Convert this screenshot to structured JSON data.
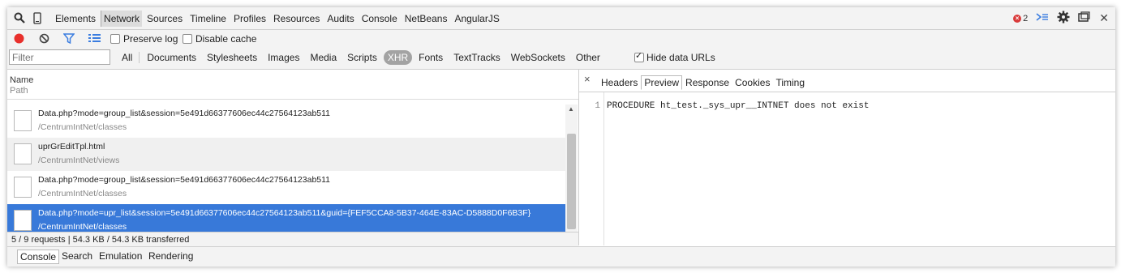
{
  "main_tabs": [
    "Elements",
    "Network",
    "Sources",
    "Timeline",
    "Profiles",
    "Resources",
    "Audits",
    "Console",
    "NetBeans",
    "AngularJS"
  ],
  "active_main_tab": "Network",
  "error_count": "2",
  "toolbar": {
    "preserve_log": "Preserve log",
    "disable_cache": "Disable cache"
  },
  "filter": {
    "placeholder": "Filter",
    "types": [
      "All",
      "Documents",
      "Stylesheets",
      "Images",
      "Media",
      "Scripts",
      "XHR",
      "Fonts",
      "TextTracks",
      "WebSockets",
      "Other"
    ],
    "active_type": "XHR",
    "hide_data_urls": "Hide data URLs"
  },
  "columns": {
    "name": "Name",
    "path": "Path"
  },
  "requests": [
    {
      "name": "Data.php?mode=group_list&session=5e491d66377606ec44c27564123ab511",
      "path": "/CentrumIntNet/classes"
    },
    {
      "name": "uprGrEditTpl.html",
      "path": "/CentrumIntNet/views"
    },
    {
      "name": "Data.php?mode=group_list&session=5e491d66377606ec44c27564123ab511",
      "path": "/CentrumIntNet/classes"
    },
    {
      "name": "Data.php?mode=upr_list&session=5e491d66377606ec44c27564123ab511&guid={FEF5CCA8-5B37-464E-83AC-D5888D0F6B3F}",
      "path": "/CentrumIntNet/classes"
    }
  ],
  "status": "5 / 9 requests | 54.3 KB / 54.3 KB transferred",
  "detail": {
    "close": "×",
    "tabs": [
      "Headers",
      "Preview",
      "Response",
      "Cookies",
      "Timing"
    ],
    "active_tab": "Preview",
    "line_number": "1",
    "content": "PROCEDURE ht_test._sys_upr__INTNET does not exist"
  },
  "drawer_tabs": [
    "Console",
    "Search",
    "Emulation",
    "Rendering"
  ],
  "active_drawer_tab": "Console",
  "colors": {
    "selected_row": "#3879d9",
    "record": "#e8302c",
    "filter_icon": "#3b7de0",
    "error_badge": "#d93a3a"
  }
}
